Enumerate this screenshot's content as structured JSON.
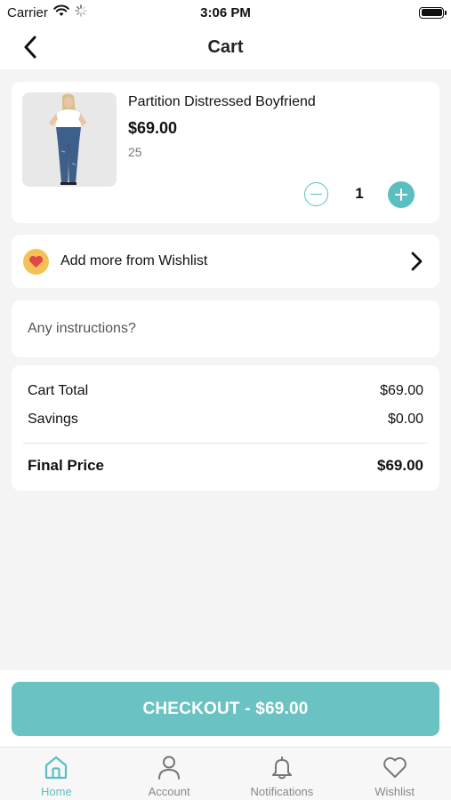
{
  "status_bar": {
    "carrier": "Carrier",
    "time": "3:06 PM"
  },
  "nav": {
    "title": "Cart"
  },
  "cart_item": {
    "name": "Partition Distressed Boyfriend",
    "price": "$69.00",
    "size": "25",
    "quantity": "1"
  },
  "wishlist_row": {
    "label": "Add more from Wishlist"
  },
  "instructions": {
    "placeholder": "Any instructions?",
    "value": ""
  },
  "totals": {
    "cart_total_label": "Cart Total",
    "cart_total_value": "$69.00",
    "savings_label": "Savings",
    "savings_value": "$0.00",
    "final_label": "Final Price",
    "final_value": "$69.00"
  },
  "checkout": {
    "label": "CHECKOUT - $69.00"
  },
  "tabs": [
    {
      "label": "Home",
      "icon": "home-icon",
      "active": true
    },
    {
      "label": "Account",
      "icon": "person-icon",
      "active": false
    },
    {
      "label": "Notifications",
      "icon": "bell-icon",
      "active": false
    },
    {
      "label": "Wishlist",
      "icon": "heart-icon",
      "active": false
    }
  ],
  "colors": {
    "accent": "#5bbfc1",
    "checkout": "#6ac2c3",
    "background": "#f4f4f4",
    "wishlist_badge": "#f4c157",
    "heart": "#e0474c"
  }
}
